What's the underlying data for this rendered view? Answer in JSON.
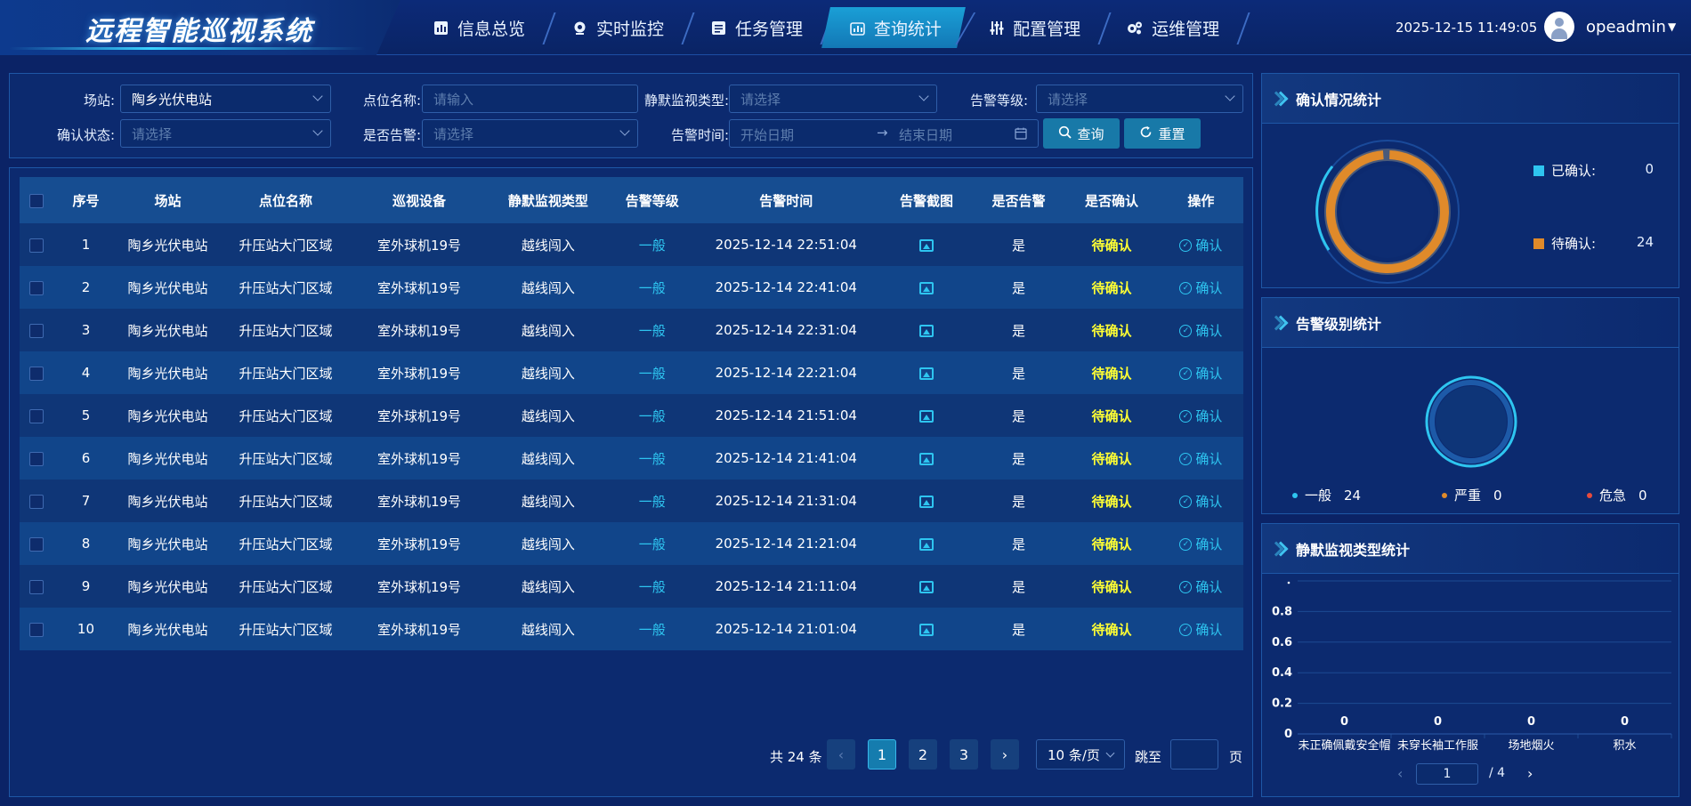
{
  "app": {
    "title": "远程智能巡视系统"
  },
  "nav": [
    {
      "label": "信息总览",
      "icon": "dashboard-icon"
    },
    {
      "label": "实时监控",
      "icon": "camera-icon"
    },
    {
      "label": "任务管理",
      "icon": "task-icon"
    },
    {
      "label": "查询统计",
      "icon": "stats-icon",
      "active": true
    },
    {
      "label": "配置管理",
      "icon": "sliders-icon"
    },
    {
      "label": "运维管理",
      "icon": "gears-icon"
    }
  ],
  "header": {
    "datetime": "2025-12-15 11:49:05",
    "user": "opeadmin"
  },
  "filters": {
    "station": {
      "label": "场站:",
      "value": "陶乡光伏电站"
    },
    "point_name": {
      "label": "点位名称:",
      "placeholder": "请输入"
    },
    "silent_type": {
      "label": "静默监视类型:",
      "placeholder": "请选择"
    },
    "alarm_level": {
      "label": "告警等级:",
      "placeholder": "请选择"
    },
    "confirm_status": {
      "label": "确认状态:",
      "placeholder": "请选择"
    },
    "is_alarm": {
      "label": "是否告警:",
      "placeholder": "请选择"
    },
    "alarm_time": {
      "label": "告警时间:",
      "start_placeholder": "开始日期",
      "end_placeholder": "结束日期",
      "separator": "→"
    },
    "query_button": "查询",
    "reset_button": "重置"
  },
  "table": {
    "columns": [
      "序号",
      "场站",
      "点位名称",
      "巡视设备",
      "静默监视类型",
      "告警等级",
      "告警时间",
      "告警截图",
      "是否告警",
      "是否确认",
      "操作"
    ],
    "confirm_action": "确认",
    "rows": [
      {
        "no": "1",
        "station": "陶乡光伏电站",
        "point": "升压站大门区域",
        "device": "室外球机19号",
        "type": "越线闯入",
        "level": "一般",
        "time": "2025-12-14 22:51:04",
        "alarm": "是",
        "confirmed": "待确认"
      },
      {
        "no": "2",
        "station": "陶乡光伏电站",
        "point": "升压站大门区域",
        "device": "室外球机19号",
        "type": "越线闯入",
        "level": "一般",
        "time": "2025-12-14 22:41:04",
        "alarm": "是",
        "confirmed": "待确认"
      },
      {
        "no": "3",
        "station": "陶乡光伏电站",
        "point": "升压站大门区域",
        "device": "室外球机19号",
        "type": "越线闯入",
        "level": "一般",
        "time": "2025-12-14 22:31:04",
        "alarm": "是",
        "confirmed": "待确认"
      },
      {
        "no": "4",
        "station": "陶乡光伏电站",
        "point": "升压站大门区域",
        "device": "室外球机19号",
        "type": "越线闯入",
        "level": "一般",
        "time": "2025-12-14 22:21:04",
        "alarm": "是",
        "confirmed": "待确认"
      },
      {
        "no": "5",
        "station": "陶乡光伏电站",
        "point": "升压站大门区域",
        "device": "室外球机19号",
        "type": "越线闯入",
        "level": "一般",
        "time": "2025-12-14 21:51:04",
        "alarm": "是",
        "confirmed": "待确认"
      },
      {
        "no": "6",
        "station": "陶乡光伏电站",
        "point": "升压站大门区域",
        "device": "室外球机19号",
        "type": "越线闯入",
        "level": "一般",
        "time": "2025-12-14 21:41:04",
        "alarm": "是",
        "confirmed": "待确认"
      },
      {
        "no": "7",
        "station": "陶乡光伏电站",
        "point": "升压站大门区域",
        "device": "室外球机19号",
        "type": "越线闯入",
        "level": "一般",
        "time": "2025-12-14 21:31:04",
        "alarm": "是",
        "confirmed": "待确认"
      },
      {
        "no": "8",
        "station": "陶乡光伏电站",
        "point": "升压站大门区域",
        "device": "室外球机19号",
        "type": "越线闯入",
        "level": "一般",
        "time": "2025-12-14 21:21:04",
        "alarm": "是",
        "confirmed": "待确认"
      },
      {
        "no": "9",
        "station": "陶乡光伏电站",
        "point": "升压站大门区域",
        "device": "室外球机19号",
        "type": "越线闯入",
        "level": "一般",
        "time": "2025-12-14 21:11:04",
        "alarm": "是",
        "confirmed": "待确认"
      },
      {
        "no": "10",
        "station": "陶乡光伏电站",
        "point": "升压站大门区域",
        "device": "室外球机19号",
        "type": "越线闯入",
        "level": "一般",
        "time": "2025-12-14 21:01:04",
        "alarm": "是",
        "confirmed": "待确认"
      }
    ]
  },
  "pagination": {
    "total_text": "共 24 条",
    "pages": [
      "1",
      "2",
      "3"
    ],
    "current": "1",
    "page_size": "10 条/页",
    "jump_label": "跳至",
    "page_suffix": "页"
  },
  "confirm_stats": {
    "title": "确认情况统计",
    "items": [
      {
        "label": "已确认:",
        "value": "0",
        "color": "#2ec5f0"
      },
      {
        "label": "待确认:",
        "value": "24",
        "color": "#e08a2a"
      }
    ]
  },
  "level_stats": {
    "title": "告警级别统计",
    "items": [
      {
        "label": "一般",
        "value": "24",
        "color": "#2ec5f0"
      },
      {
        "label": "严重",
        "value": "0",
        "color": "#e08a2a"
      },
      {
        "label": "危急",
        "value": "0",
        "color": "#e84b3c"
      }
    ]
  },
  "type_stats": {
    "title": "静默监视类型统计",
    "pager": {
      "current": "1",
      "total": "/ 4"
    }
  },
  "chart_data": {
    "type": "bar",
    "categories": [
      "未正确佩戴安全帽",
      "未穿长袖工作服",
      "场地烟火",
      "积水"
    ],
    "values": [
      0,
      0,
      0,
      0
    ],
    "ylim": [
      0,
      1
    ],
    "yticks": [
      "0",
      "0.2",
      "0.4",
      "0.6",
      "0.8"
    ],
    "grid": true
  }
}
